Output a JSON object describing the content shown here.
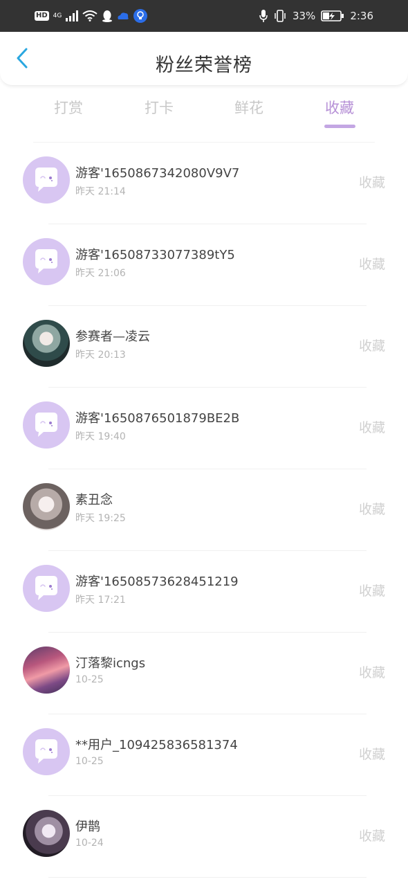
{
  "status_bar": {
    "hd": "HD",
    "net": "4G",
    "battery": "33%",
    "time": "2:36"
  },
  "header": {
    "title": "粉丝荣誉榜"
  },
  "tabs": [
    {
      "label": "打赏",
      "active": false
    },
    {
      "label": "打卡",
      "active": false
    },
    {
      "label": "鲜花",
      "active": false
    },
    {
      "label": "收藏",
      "active": true
    }
  ],
  "colors": {
    "accent": "#b690d6",
    "tab_underline": "#c3a6e3",
    "default_avatar": "#d8c6f2"
  },
  "list": [
    {
      "name": "游客'1650867342080V9V7",
      "time": "昨天 21:14",
      "action": "收藏",
      "avatar": "default-chat-avatar"
    },
    {
      "name": "游客'16508733077389tY5",
      "time": "昨天 21:06",
      "action": "收藏",
      "avatar": "default-chat-avatar"
    },
    {
      "name": "参赛者—凌云",
      "time": "昨天 20:13",
      "action": "收藏",
      "avatar": "anime-avatar"
    },
    {
      "name": "游客'1650876501879BE2B",
      "time": "昨天 19:40",
      "action": "收藏",
      "avatar": "default-chat-avatar"
    },
    {
      "name": "素丑念",
      "time": "昨天 19:25",
      "action": "收藏",
      "avatar": "anime-avatar"
    },
    {
      "name": "游客'16508573628451219",
      "time": "昨天 17:21",
      "action": "收藏",
      "avatar": "default-chat-avatar"
    },
    {
      "name": "汀落黎icngs",
      "time": "10-25",
      "action": "收藏",
      "avatar": "sunset-avatar"
    },
    {
      "name": "**用户_109425836581374",
      "time": "10-25",
      "action": "收藏",
      "avatar": "default-chat-avatar"
    },
    {
      "name": "伊鹊",
      "time": "10-24",
      "action": "收藏",
      "avatar": "anime-avatar"
    }
  ]
}
